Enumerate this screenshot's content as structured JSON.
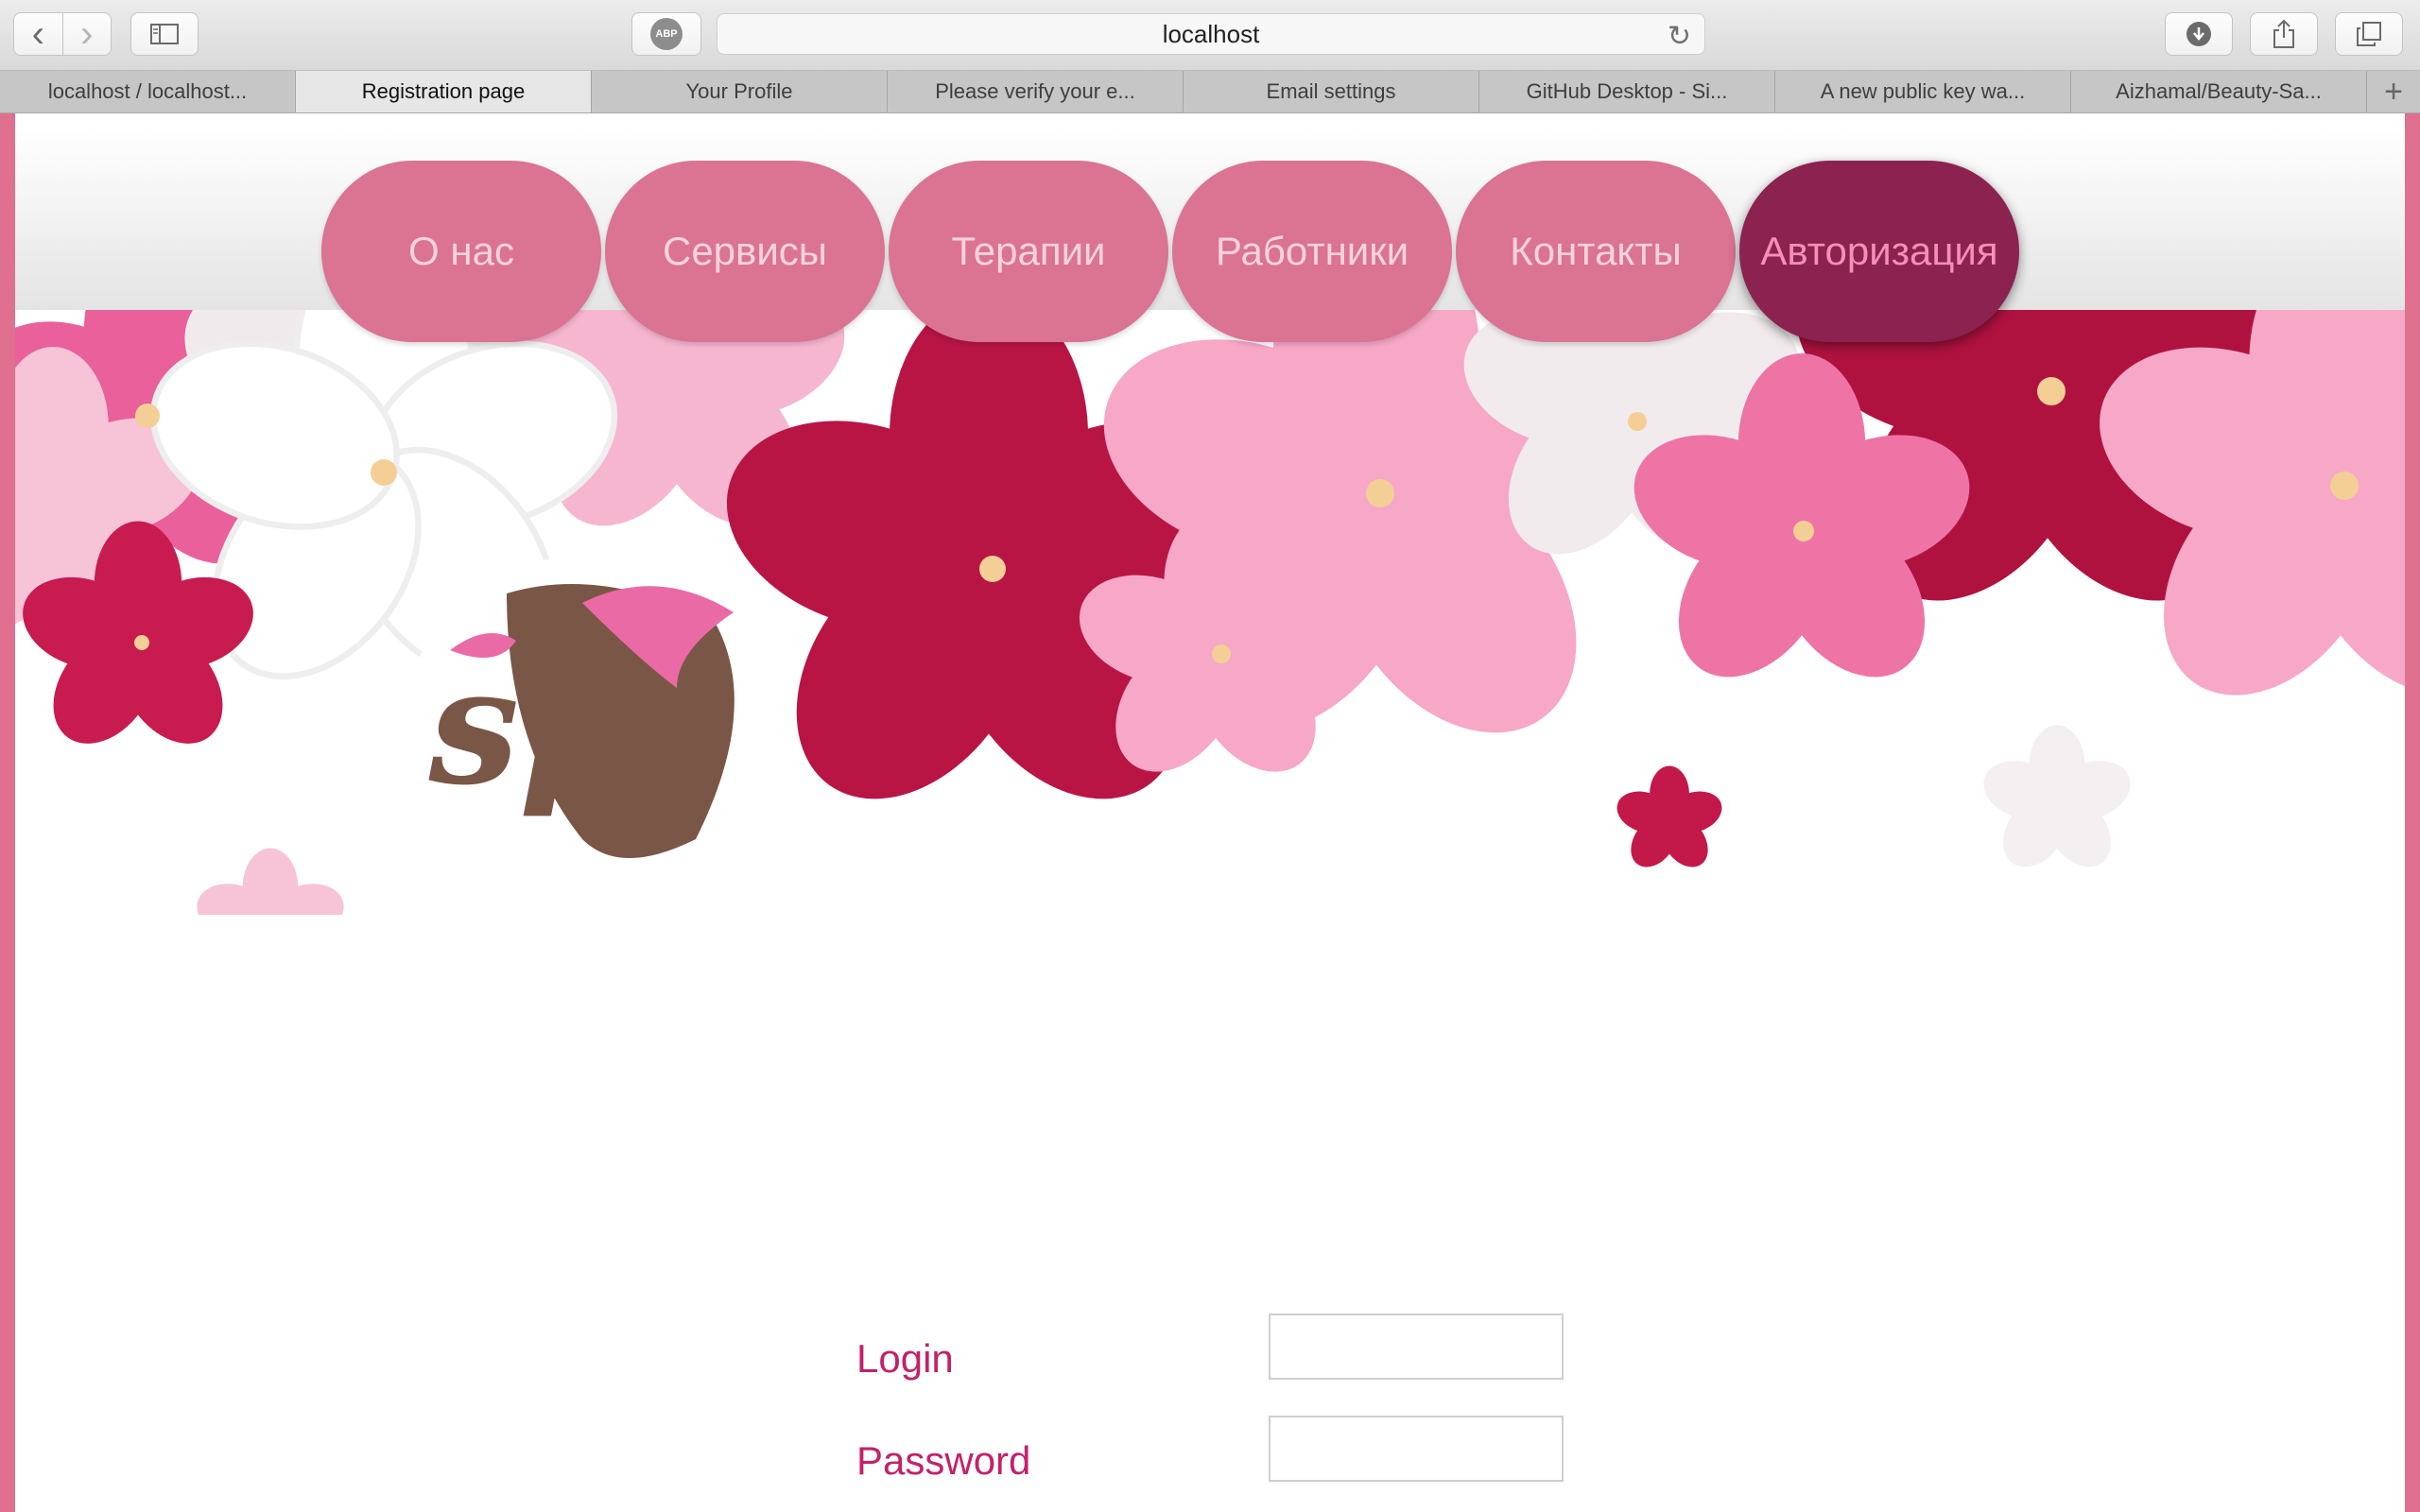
{
  "browser": {
    "url": "localhost",
    "adblock_label": "ABP",
    "back_glyph": "‹",
    "forward_glyph": "›",
    "reload_glyph": "↻",
    "new_tab_glyph": "+",
    "tabs": [
      {
        "label": "localhost / localhost..."
      },
      {
        "label": "Registration page"
      },
      {
        "label": "Your Profile"
      },
      {
        "label": "Please verify your e..."
      },
      {
        "label": "Email settings"
      },
      {
        "label": "GitHub Desktop - Si..."
      },
      {
        "label": "A new public key wa..."
      },
      {
        "label": "Aizhamal/Beauty-Sa..."
      }
    ],
    "active_tab": 1,
    "icons": {
      "sidebar": "sidebar-icon",
      "download": "download-icon",
      "share": "share-icon",
      "tabs": "tabs-overview-icon"
    }
  },
  "site": {
    "logo_text": "spa",
    "nav": [
      {
        "label": "О нас"
      },
      {
        "label": "Сервисы"
      },
      {
        "label": "Терапии"
      },
      {
        "label": "Работники"
      },
      {
        "label": "Контакты"
      },
      {
        "label": "Авторизация",
        "active": true
      }
    ],
    "form": {
      "login_label": "Login",
      "login_value": "",
      "password_label": "Password",
      "password_value": ""
    }
  },
  "colors": {
    "accent": "#db7392",
    "active_nav": "#8b2250",
    "label_text": "#c2226a",
    "page_border": "#e07090"
  }
}
